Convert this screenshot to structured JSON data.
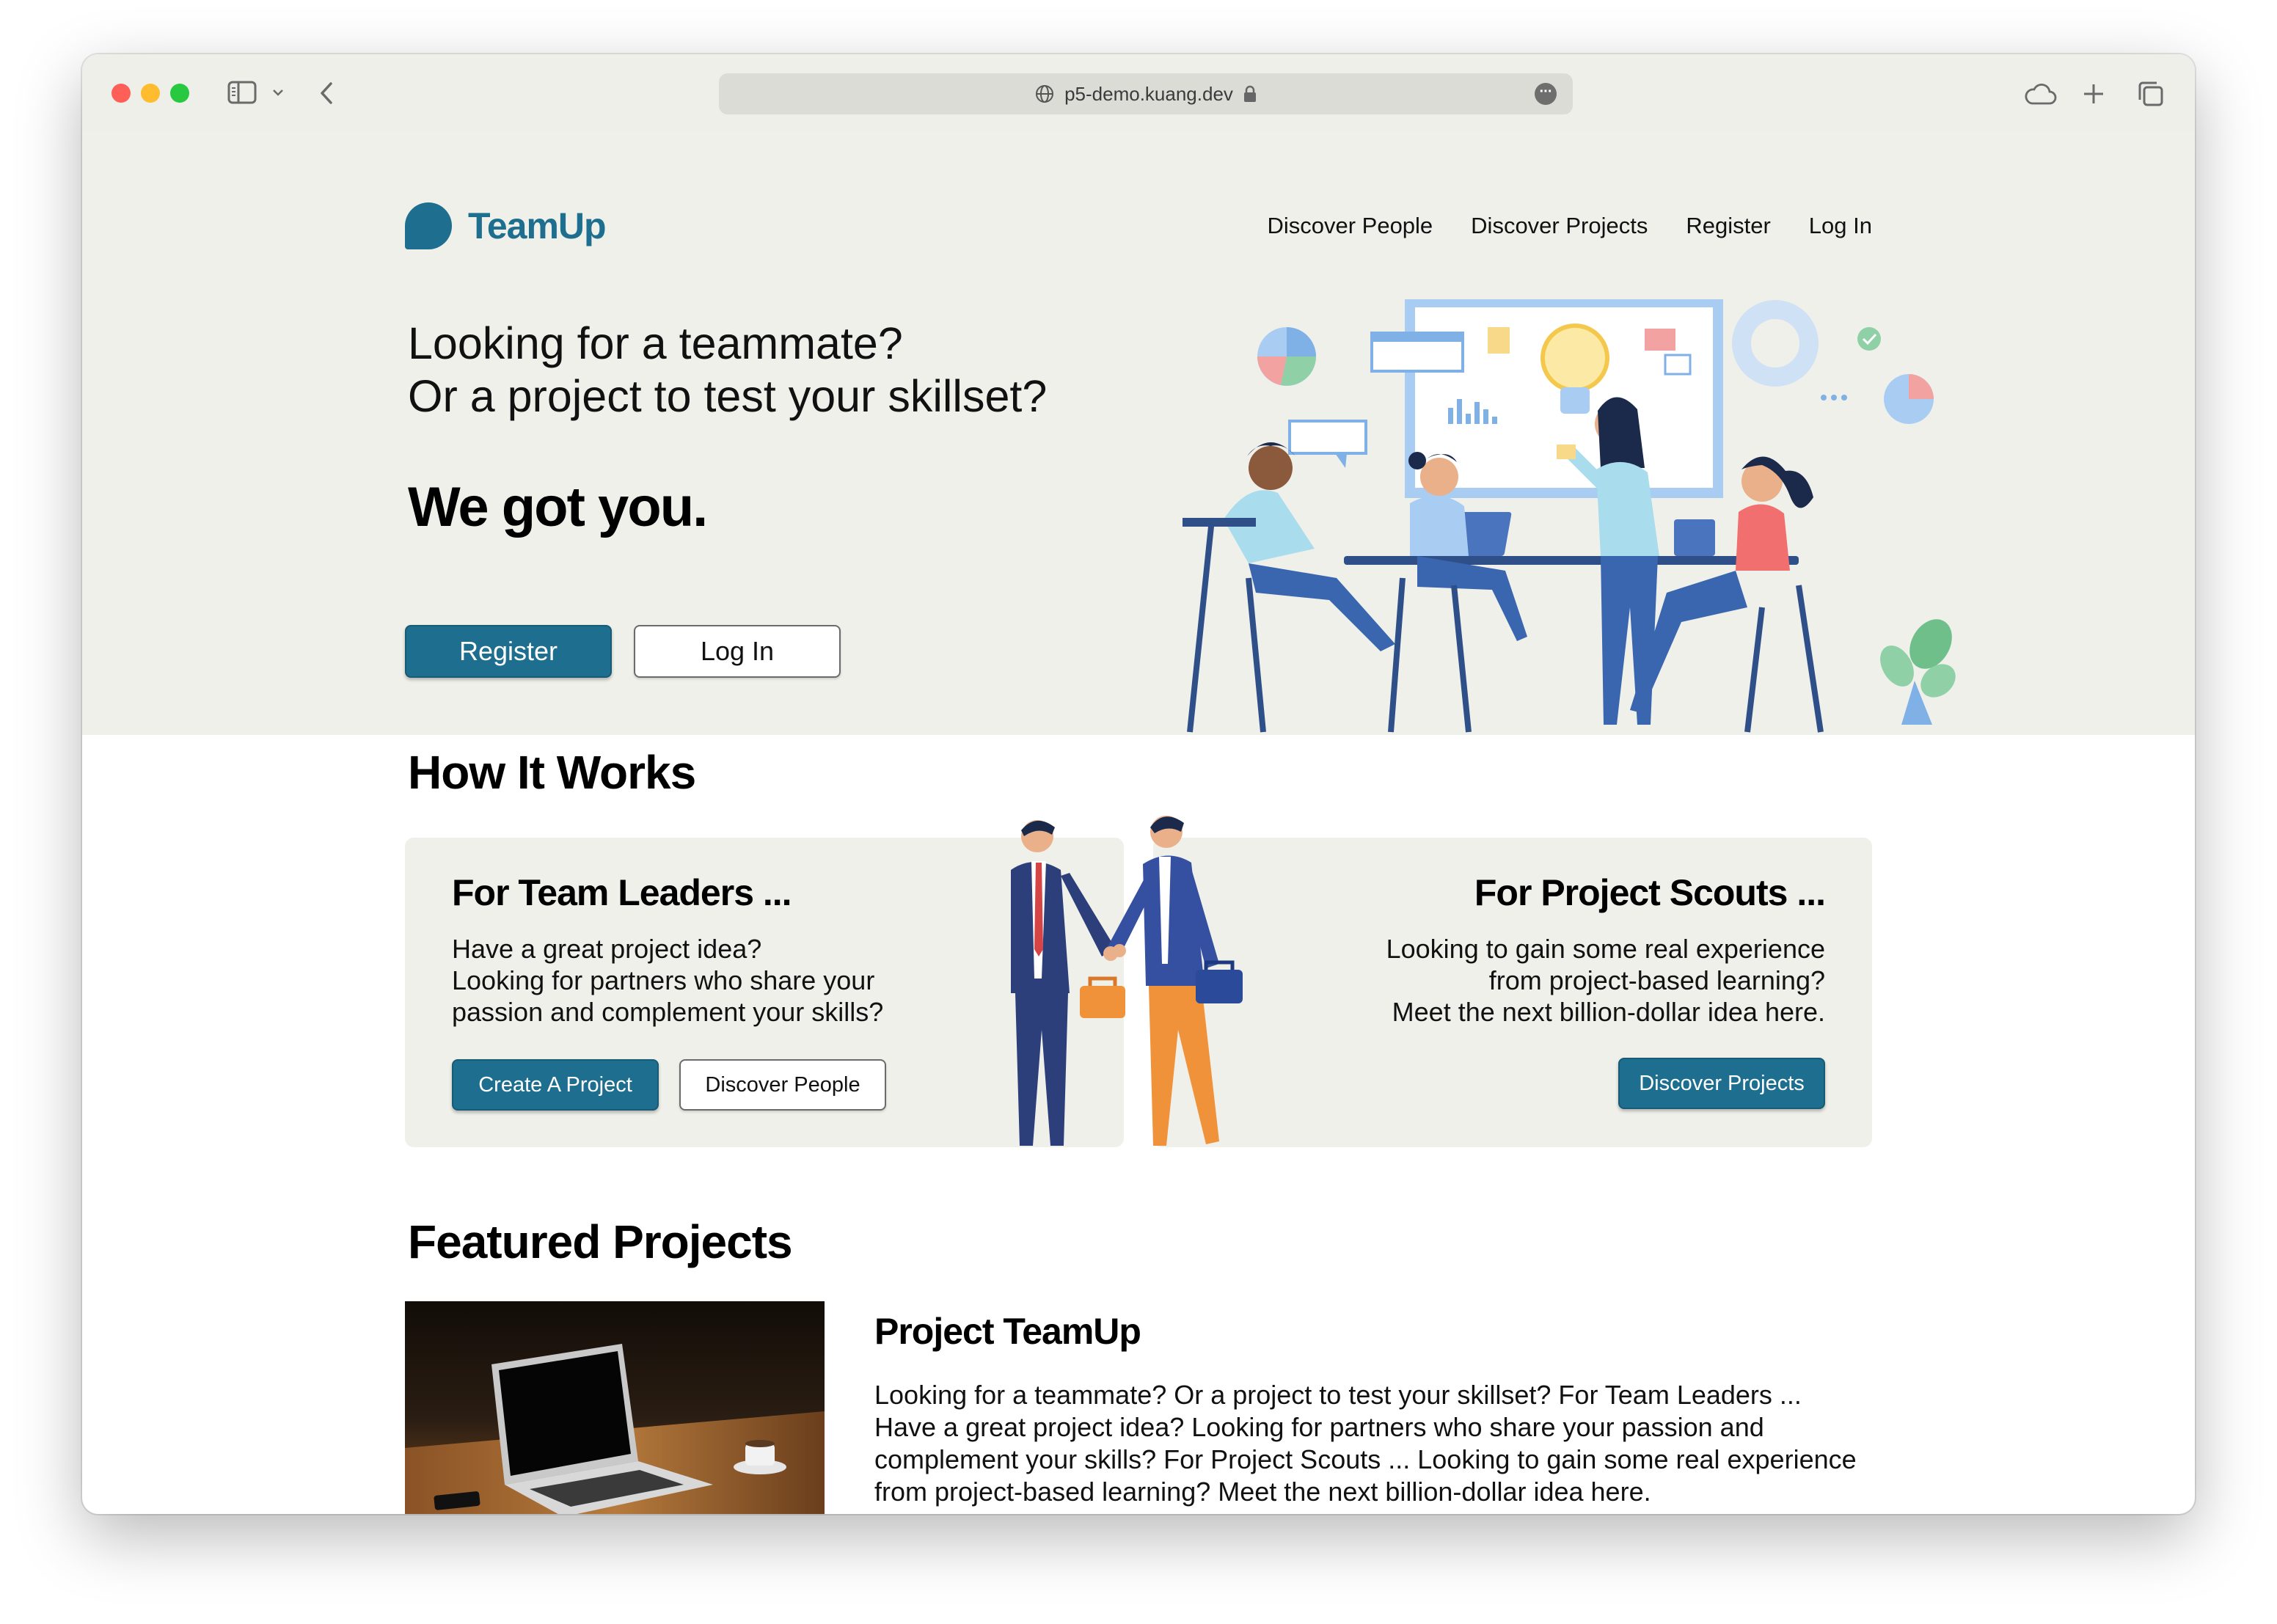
{
  "browser": {
    "url": "p5-demo.kuang.dev"
  },
  "brand": {
    "name": "TeamUp",
    "color": "#1d6e8f"
  },
  "nav": {
    "items": [
      {
        "label": "Discover People"
      },
      {
        "label": "Discover Projects"
      },
      {
        "label": "Register"
      },
      {
        "label": "Log In"
      }
    ]
  },
  "hero": {
    "line1": "Looking for a teammate?",
    "line2": "Or a project to test your skillset?",
    "tagline": "We got you.",
    "register_label": "Register",
    "login_label": "Log In"
  },
  "how_it_works": {
    "title": "How It Works",
    "leaders": {
      "title": "For Team Leaders ...",
      "lines": [
        "Have a great project idea?",
        "Looking for partners who share your",
        "passion and complement your skills?"
      ],
      "create_label": "Create A Project",
      "discover_label": "Discover People"
    },
    "scouts": {
      "title": "For Project Scouts ...",
      "lines": [
        "Looking to gain some real experience",
        "from project-based learning?",
        "Meet the next billion-dollar idea here."
      ],
      "discover_label": "Discover Projects"
    }
  },
  "featured": {
    "title": "Featured Projects",
    "project": {
      "title": "Project TeamUp",
      "description": "Looking for a teammate? Or a project to test your skillset? For Team Leaders ... Have a great project idea? Looking for partners who share your passion and complement your skills? For Project Scouts ... Looking to gain some real experience from project-based learning? Meet the next billion-dollar idea here."
    }
  },
  "colors": {
    "accent": "#1d6e8f",
    "hero_bg": "#f0f0eb",
    "card_bg": "#f0f0eb"
  }
}
